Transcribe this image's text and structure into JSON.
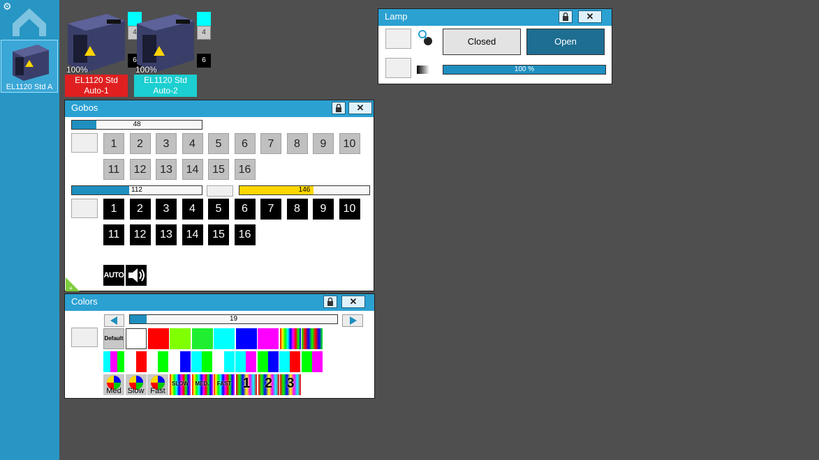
{
  "sidebar": {
    "fixture_label": "EL1120 Std A"
  },
  "fixtures": [
    {
      "percent": "100%",
      "name_line1": "EL1120 Std",
      "name_line2": "Auto-1",
      "color": "#e02020",
      "indicator_value": "4",
      "black_value": "6"
    },
    {
      "percent": "100%",
      "name_line1": "EL1120 Std",
      "name_line2": "Auto-2",
      "color": "#1ccfd0",
      "indicator_value": "4",
      "black_value": "6"
    }
  ],
  "lamp": {
    "title": "Lamp",
    "closed_label": "Closed",
    "open_label": "Open",
    "dimmer_value": "100 %",
    "dimmer_fraction": 1.0
  },
  "gobos": {
    "title": "Gobos",
    "slider1_value": "48",
    "slider1_fraction": 0.19,
    "grey_buttons": [
      "1",
      "2",
      "3",
      "4",
      "5",
      "6",
      "7",
      "8",
      "9",
      "10",
      "11",
      "12",
      "13",
      "14",
      "15",
      "16"
    ],
    "slider2_value": "112",
    "slider2_fraction": 0.44,
    "slider3_value": "146",
    "slider3_fraction": 0.57,
    "black_buttons": [
      "1",
      "2",
      "3",
      "4",
      "5",
      "6",
      "7",
      "8",
      "9",
      "10",
      "11",
      "12",
      "13",
      "14",
      "15",
      "16"
    ],
    "auto_label": "AUTO"
  },
  "colors": {
    "title": "Colors",
    "slider_value": "19",
    "slider_fraction": 0.08,
    "default_label": "Default",
    "row1": [
      "#ffffff",
      "#ff0000",
      "#80ff00",
      "#20ee30",
      "#00ffff",
      "#0000ff",
      "#ff00ff"
    ],
    "row2_pairs": [
      [
        "#00ffff",
        "#ff00ff",
        "#00ff00"
      ],
      [
        "#ffffff",
        "#ff0000"
      ],
      [
        "#ffffff",
        "#00ff00"
      ],
      [
        "#ffffff",
        "#0000ff"
      ],
      [
        "#00ffff",
        "#00ff00"
      ],
      [
        "#ffffff",
        "#00ffff"
      ],
      [
        "#00ffff",
        "#ff00ff"
      ],
      [
        "#00ff00",
        "#0000ff"
      ],
      [
        "#00ffff",
        "#ff0000"
      ],
      [
        "#00ff00",
        "#ff00ff"
      ]
    ],
    "speed_labels": [
      "Med",
      "Slow",
      "Fast"
    ],
    "chase_labels": [
      "SLOW",
      "MED.",
      "FAST"
    ],
    "number_labels": [
      "1",
      "2",
      "3"
    ]
  }
}
